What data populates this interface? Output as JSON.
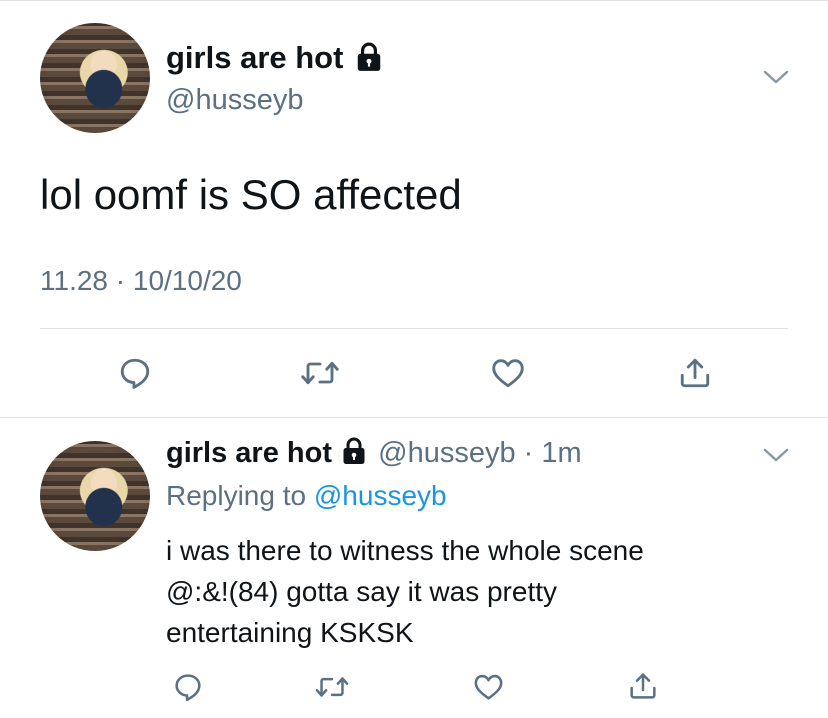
{
  "tweet": {
    "display_name": "girls are hot",
    "handle": "@husseyb",
    "text": "lol oomf is SO affected",
    "timestamp": "11.28 · 10/10/20"
  },
  "reply": {
    "display_name": "girls are hot",
    "handle": "@husseyb",
    "time_ago": "1m",
    "replying_to_label": "Replying to",
    "replying_to_handle": "@husseyb",
    "text_lines": [
      "i was there to witness the whole scene",
      "@:&!(84) gotta say it was pretty",
      "entertaining KSKSK"
    ]
  },
  "icons": {
    "lock": "lock-icon",
    "more": "chevron-down-icon",
    "reply": "comment-icon",
    "retweet": "retweet-icon",
    "like": "heart-icon",
    "share": "share-icon"
  },
  "colors": {
    "text_primary": "#0f1419",
    "text_secondary": "#5b7083",
    "link": "#1b95e0",
    "divider": "#dfe3e6"
  }
}
